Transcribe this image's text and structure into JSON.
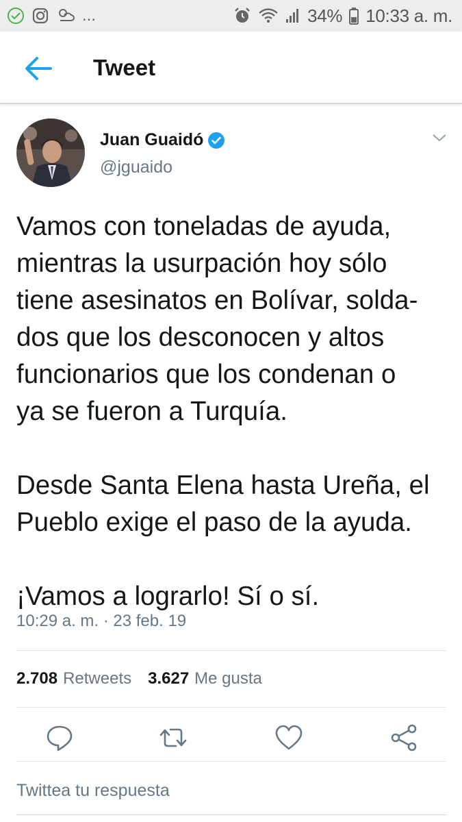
{
  "status_bar": {
    "left_icons": [
      "check-circle-icon",
      "instagram-icon",
      "weather-icon"
    ],
    "overflow": "...",
    "battery": "34%",
    "time": "10:33 a. m."
  },
  "header": {
    "title": "Tweet",
    "back_icon": "arrow-left-icon"
  },
  "tweet": {
    "author_name": "Juan Guaidó",
    "handle": "@jguaido",
    "verified": true,
    "paragraphs": [
      "Vamos con toneladas de ayuda,\nmientras la usurpación hoy sólo\ntiene asesinatos en Bolívar, solda-\ndos que los desconocen y altos\nfuncionarios que los condenan o\nya se fueron a Turquía.",
      "Desde Santa Elena hasta Ureña, el\nPueblo exige el paso de la ayuda.",
      "¡Vamos a lograrlo! Sí o sí."
    ],
    "timestamp": "10:29 a. m. · 23 feb. 19",
    "retweets_count": "2.708",
    "retweets_label": "Retweets",
    "likes_count": "3.627",
    "likes_label": "Me gusta"
  },
  "actions": [
    "reply-icon",
    "retweet-icon",
    "like-icon",
    "share-icon"
  ],
  "reply_placeholder": "Twittea tu respuesta",
  "colors": {
    "accent": "#1da1f2",
    "secondary_text": "#657786",
    "primary_text": "#14171a"
  }
}
